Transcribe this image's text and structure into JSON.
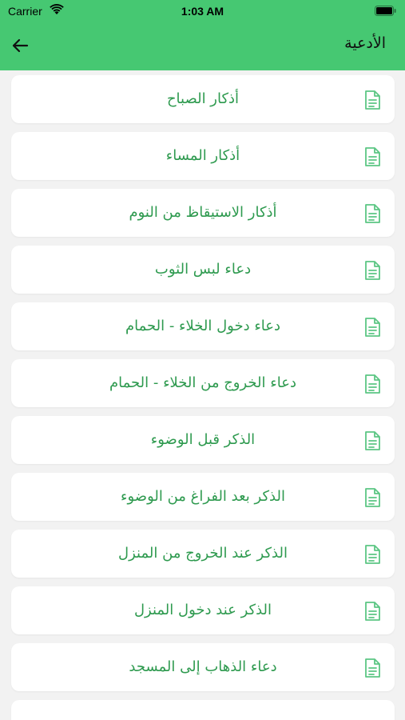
{
  "status_bar": {
    "carrier": "Carrier",
    "time": "1:03 AM"
  },
  "header": {
    "title": "الأدعية",
    "back_icon": "arrow-left-icon",
    "color": "#46c872"
  },
  "colors": {
    "accent": "#2e9a4f",
    "icon": "#5cc684",
    "background": "#f2f2f2"
  },
  "list": {
    "item_icon": "document-icon",
    "items": [
      {
        "label": "أذكار الصباح"
      },
      {
        "label": "أذكار المساء"
      },
      {
        "label": "أذكار الاستيقاظ من النوم"
      },
      {
        "label": "دعاء لبس الثوب"
      },
      {
        "label": "دعاء دخول الخلاء - الحمام"
      },
      {
        "label": "دعاء الخروج من الخلاء - الحمام"
      },
      {
        "label": "الذكر قبل الوضوء"
      },
      {
        "label": "الذكر بعد الفراغ من الوضوء"
      },
      {
        "label": "الذكر عند الخروج من المنزل"
      },
      {
        "label": "الذكر عند دخول المنزل"
      },
      {
        "label": "دعاء الذهاب إلى المسجد"
      },
      {
        "label": ""
      }
    ]
  }
}
